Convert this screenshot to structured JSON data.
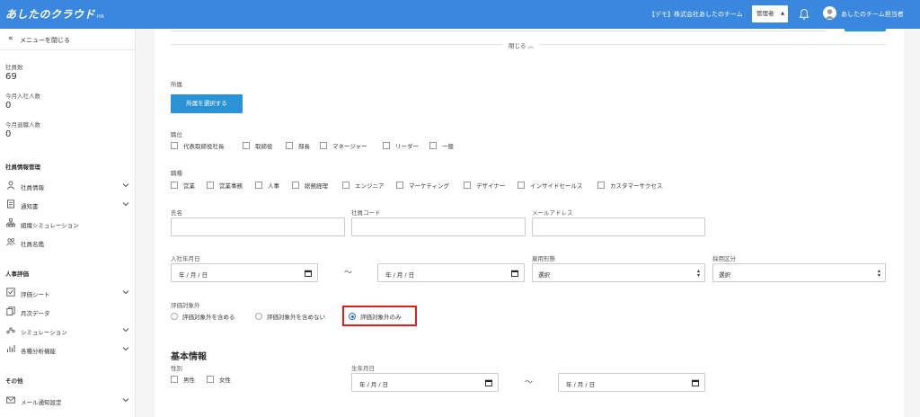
{
  "header": {
    "logo": "あしたのクラウド",
    "logo_suffix": "HR",
    "company": "【デモ】株式会社あしたのチーム",
    "role_select": "管理者",
    "user_name": "あしたのチーム担当者",
    "bg_color": "#3a87e0"
  },
  "sidebar": {
    "close_menu": "メニューを閉じる",
    "stats": [
      {
        "label": "社員数",
        "value": "69"
      },
      {
        "label": "今月入社人数",
        "value": "0"
      },
      {
        "label": "今月退職人数",
        "value": "0"
      }
    ],
    "section_employee": "社員情報管理",
    "employee_items": [
      {
        "label": "社員情報",
        "icon": "person-icon",
        "expandable": true
      },
      {
        "label": "通知書",
        "icon": "document-icon",
        "expandable": true
      },
      {
        "label": "組織シミュレーション",
        "icon": "org-chart-icon",
        "expandable": false
      },
      {
        "label": "社員名鑑",
        "icon": "people-icon",
        "expandable": false
      }
    ],
    "section_eval": "人事評価",
    "eval_items": [
      {
        "label": "評価シート",
        "icon": "checklist-icon",
        "expandable": true
      },
      {
        "label": "月次データ",
        "icon": "copy-icon",
        "expandable": false
      },
      {
        "label": "シミュレーション",
        "icon": "scatter-icon",
        "expandable": true
      },
      {
        "label": "各種分析機能",
        "icon": "bar-chart-icon",
        "expandable": true
      }
    ],
    "section_other": "その他",
    "other_items": [
      {
        "label": "メール通知設定",
        "icon": "mail-icon",
        "expandable": true
      }
    ]
  },
  "form": {
    "collapse_label": "閉じる",
    "affiliation_label": "所属",
    "affiliation_button": "所属を選択する",
    "position_label": "職位",
    "positions": [
      "代表取締役社長",
      "取締役",
      "部長",
      "マネージャー",
      "リーダー",
      "一般"
    ],
    "occupation_label": "職種",
    "occupations": [
      "営業",
      "営業事務",
      "人事",
      "総務経理",
      "エンジニア",
      "マーケティング",
      "デザイナー",
      "インサイドセールス",
      "カスタマーサクセス"
    ],
    "name_label": "氏名",
    "employee_code_label": "社員コード",
    "email_label": "メールアドレス",
    "hire_date_label": "入社年月日",
    "date_placeholder": "年 / 月 / 日",
    "date_range_separator": "～",
    "employment_type_label": "雇用形態",
    "employment_type_value": "選択",
    "hiring_category_label": "採用区分",
    "hiring_category_value": "選択",
    "eval_exclusion_label": "評価対象外",
    "eval_options": [
      {
        "label": "評価対象外を含める",
        "selected": false
      },
      {
        "label": "評価対象外を含めない",
        "selected": false
      },
      {
        "label": "評価対象外のみ",
        "selected": true
      }
    ],
    "basic_info_heading": "基本情報",
    "gender_label": "性別",
    "genders": [
      "男性",
      "女性"
    ],
    "birth_date_label": "生年月日",
    "accent_color": "#2a93d5",
    "highlight_color": "#e21d1d"
  }
}
